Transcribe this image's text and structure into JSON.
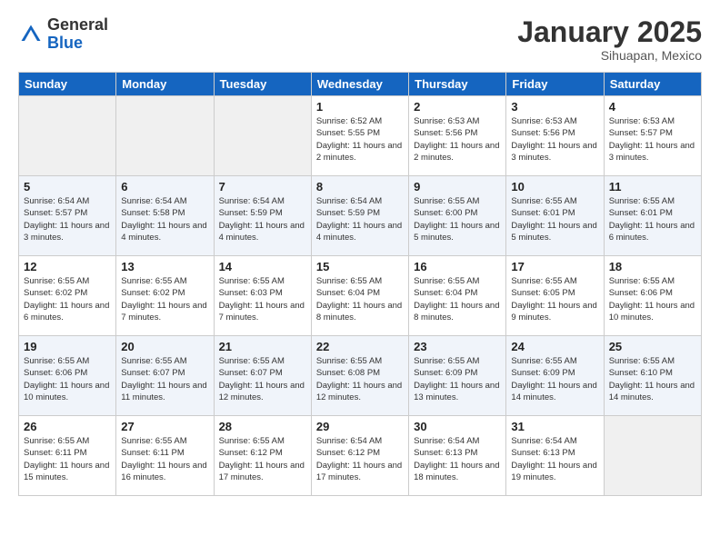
{
  "header": {
    "logo_general": "General",
    "logo_blue": "Blue",
    "month": "January 2025",
    "location": "Sihuapan, Mexico"
  },
  "weekdays": [
    "Sunday",
    "Monday",
    "Tuesday",
    "Wednesday",
    "Thursday",
    "Friday",
    "Saturday"
  ],
  "weeks": [
    [
      {
        "day": "",
        "info": ""
      },
      {
        "day": "",
        "info": ""
      },
      {
        "day": "",
        "info": ""
      },
      {
        "day": "1",
        "info": "Sunrise: 6:52 AM\nSunset: 5:55 PM\nDaylight: 11 hours\nand 2 minutes."
      },
      {
        "day": "2",
        "info": "Sunrise: 6:53 AM\nSunset: 5:56 PM\nDaylight: 11 hours\nand 2 minutes."
      },
      {
        "day": "3",
        "info": "Sunrise: 6:53 AM\nSunset: 5:56 PM\nDaylight: 11 hours\nand 3 minutes."
      },
      {
        "day": "4",
        "info": "Sunrise: 6:53 AM\nSunset: 5:57 PM\nDaylight: 11 hours\nand 3 minutes."
      }
    ],
    [
      {
        "day": "5",
        "info": "Sunrise: 6:54 AM\nSunset: 5:57 PM\nDaylight: 11 hours\nand 3 minutes."
      },
      {
        "day": "6",
        "info": "Sunrise: 6:54 AM\nSunset: 5:58 PM\nDaylight: 11 hours\nand 4 minutes."
      },
      {
        "day": "7",
        "info": "Sunrise: 6:54 AM\nSunset: 5:59 PM\nDaylight: 11 hours\nand 4 minutes."
      },
      {
        "day": "8",
        "info": "Sunrise: 6:54 AM\nSunset: 5:59 PM\nDaylight: 11 hours\nand 4 minutes."
      },
      {
        "day": "9",
        "info": "Sunrise: 6:55 AM\nSunset: 6:00 PM\nDaylight: 11 hours\nand 5 minutes."
      },
      {
        "day": "10",
        "info": "Sunrise: 6:55 AM\nSunset: 6:01 PM\nDaylight: 11 hours\nand 5 minutes."
      },
      {
        "day": "11",
        "info": "Sunrise: 6:55 AM\nSunset: 6:01 PM\nDaylight: 11 hours\nand 6 minutes."
      }
    ],
    [
      {
        "day": "12",
        "info": "Sunrise: 6:55 AM\nSunset: 6:02 PM\nDaylight: 11 hours\nand 6 minutes."
      },
      {
        "day": "13",
        "info": "Sunrise: 6:55 AM\nSunset: 6:02 PM\nDaylight: 11 hours\nand 7 minutes."
      },
      {
        "day": "14",
        "info": "Sunrise: 6:55 AM\nSunset: 6:03 PM\nDaylight: 11 hours\nand 7 minutes."
      },
      {
        "day": "15",
        "info": "Sunrise: 6:55 AM\nSunset: 6:04 PM\nDaylight: 11 hours\nand 8 minutes."
      },
      {
        "day": "16",
        "info": "Sunrise: 6:55 AM\nSunset: 6:04 PM\nDaylight: 11 hours\nand 8 minutes."
      },
      {
        "day": "17",
        "info": "Sunrise: 6:55 AM\nSunset: 6:05 PM\nDaylight: 11 hours\nand 9 minutes."
      },
      {
        "day": "18",
        "info": "Sunrise: 6:55 AM\nSunset: 6:06 PM\nDaylight: 11 hours\nand 10 minutes."
      }
    ],
    [
      {
        "day": "19",
        "info": "Sunrise: 6:55 AM\nSunset: 6:06 PM\nDaylight: 11 hours\nand 10 minutes."
      },
      {
        "day": "20",
        "info": "Sunrise: 6:55 AM\nSunset: 6:07 PM\nDaylight: 11 hours\nand 11 minutes."
      },
      {
        "day": "21",
        "info": "Sunrise: 6:55 AM\nSunset: 6:07 PM\nDaylight: 11 hours\nand 12 minutes."
      },
      {
        "day": "22",
        "info": "Sunrise: 6:55 AM\nSunset: 6:08 PM\nDaylight: 11 hours\nand 12 minutes."
      },
      {
        "day": "23",
        "info": "Sunrise: 6:55 AM\nSunset: 6:09 PM\nDaylight: 11 hours\nand 13 minutes."
      },
      {
        "day": "24",
        "info": "Sunrise: 6:55 AM\nSunset: 6:09 PM\nDaylight: 11 hours\nand 14 minutes."
      },
      {
        "day": "25",
        "info": "Sunrise: 6:55 AM\nSunset: 6:10 PM\nDaylight: 11 hours\nand 14 minutes."
      }
    ],
    [
      {
        "day": "26",
        "info": "Sunrise: 6:55 AM\nSunset: 6:11 PM\nDaylight: 11 hours\nand 15 minutes."
      },
      {
        "day": "27",
        "info": "Sunrise: 6:55 AM\nSunset: 6:11 PM\nDaylight: 11 hours\nand 16 minutes."
      },
      {
        "day": "28",
        "info": "Sunrise: 6:55 AM\nSunset: 6:12 PM\nDaylight: 11 hours\nand 17 minutes."
      },
      {
        "day": "29",
        "info": "Sunrise: 6:54 AM\nSunset: 6:12 PM\nDaylight: 11 hours\nand 17 minutes."
      },
      {
        "day": "30",
        "info": "Sunrise: 6:54 AM\nSunset: 6:13 PM\nDaylight: 11 hours\nand 18 minutes."
      },
      {
        "day": "31",
        "info": "Sunrise: 6:54 AM\nSunset: 6:13 PM\nDaylight: 11 hours\nand 19 minutes."
      },
      {
        "day": "",
        "info": ""
      }
    ]
  ]
}
